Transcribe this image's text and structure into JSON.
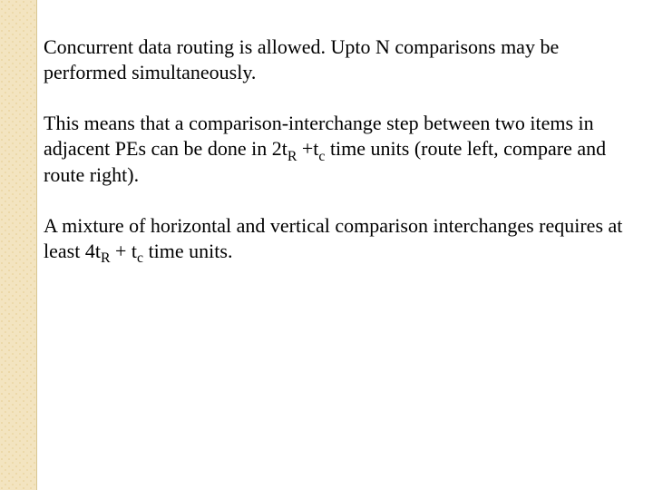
{
  "slide": {
    "paragraphs": {
      "p1": "Concurrent data routing is allowed. Upto N comparisons may be performed simultaneously.",
      "p2_a": "This means that a comparison-interchange step between two items in adjacent PEs can be done in 2t",
      "p2_sub1": "R",
      "p2_b": " +t",
      "p2_sub2": "c",
      "p2_c": " time units (route left, compare and route right).",
      "p3_a": "A mixture of horizontal and vertical comparison interchanges requires at least 4t",
      "p3_sub1": "R",
      "p3_b": " + t",
      "p3_sub2": "c",
      "p3_c": " time units."
    }
  }
}
